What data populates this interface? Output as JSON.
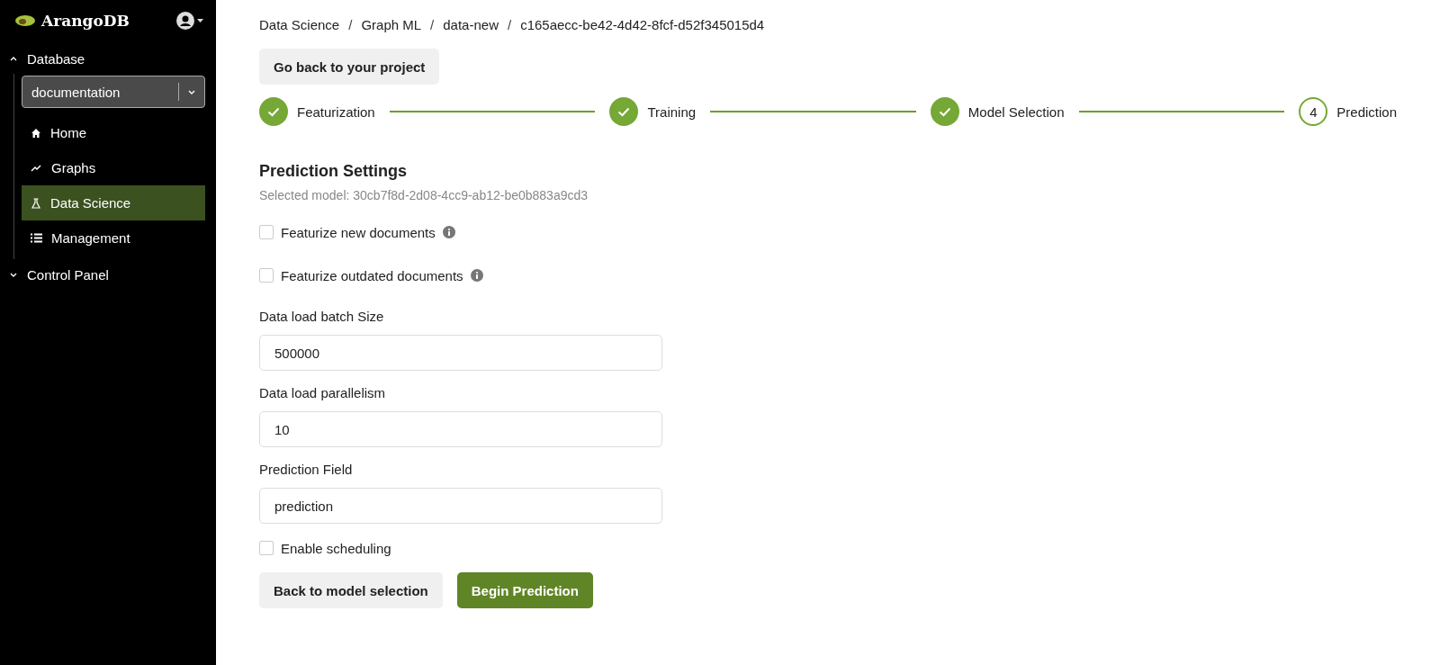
{
  "sidebar": {
    "brand": "ArangoDB",
    "sections": [
      {
        "label": "Database",
        "expanded": true,
        "database_select": {
          "value": "documentation"
        },
        "items": [
          {
            "label": "Home",
            "kind": "home",
            "selected": false
          },
          {
            "label": "Graphs",
            "kind": "graphs",
            "selected": false
          },
          {
            "label": "Data Science",
            "kind": "flask",
            "selected": true
          },
          {
            "label": "Management",
            "kind": "list",
            "selected": false
          }
        ]
      },
      {
        "label": "Control Panel",
        "expanded": false
      }
    ]
  },
  "breadcrumbs": [
    {
      "label": "Data Science"
    },
    {
      "separator": "/",
      "label": "Graph ML"
    },
    {
      "separator": "/",
      "label": "data-new"
    },
    {
      "separator": "/",
      "label": "c165aecc-be42-4d42-8fcf-d52f345015d4"
    }
  ],
  "back_button": "Go back to your project",
  "steps": [
    {
      "label": "Featurization",
      "completed": true
    },
    {
      "label": "Training",
      "completed": true
    },
    {
      "label": "Model Selection",
      "completed": true
    },
    {
      "number": "4",
      "label": "Prediction",
      "completed": false
    }
  ],
  "settings": {
    "title": "Prediction Settings",
    "subtitle": "Selected model: 30cb7f8d-2d08-4cc9-ab12-be0b883a9cd3",
    "fields": [
      {
        "kind": "checkbox",
        "label": "Featurize new documents",
        "checked": false,
        "info": true
      },
      {
        "kind": "checkbox",
        "label": "Featurize outdated documents",
        "checked": false,
        "info": true
      },
      {
        "kind": "input",
        "label": "Data load batch Size",
        "value": "500000"
      },
      {
        "kind": "input",
        "label": "Data load parallelism",
        "value": "10"
      },
      {
        "kind": "input",
        "label": "Prediction Field",
        "value": "prediction"
      },
      {
        "kind": "checkbox",
        "label": "Enable scheduling",
        "checked": false,
        "info": false
      }
    ]
  },
  "actions": [
    {
      "label": "Back to model selection",
      "kind": "secondary"
    },
    {
      "label": "Begin Prediction",
      "kind": "primary"
    }
  ]
}
